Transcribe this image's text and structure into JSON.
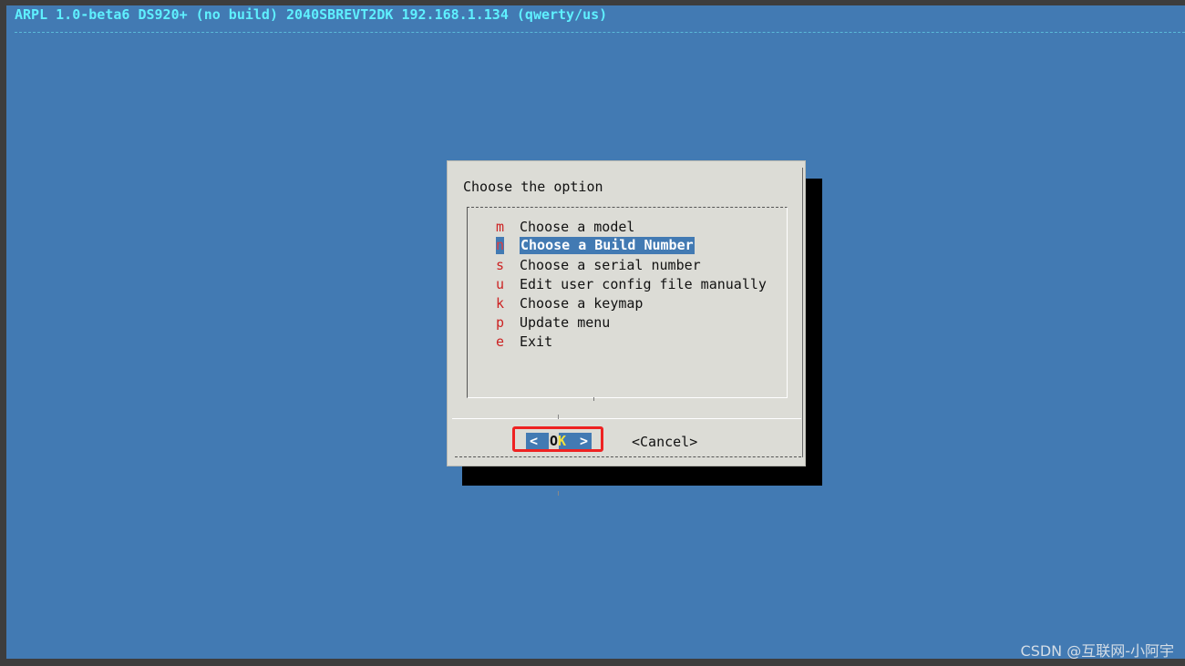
{
  "backtitle": "ARPL 1.0-beta6 DS920+ (no build) 2040SBREVT2DK 192.168.1.134 (qwerty/us)",
  "dialog": {
    "title": "Choose the option",
    "menu": [
      {
        "key": "m",
        "label": "Choose a model",
        "selected": false
      },
      {
        "key": "n",
        "label": "Choose a Build Number",
        "selected": true
      },
      {
        "key": "s",
        "label": "Choose a serial number",
        "selected": false
      },
      {
        "key": "u",
        "label": "Edit user config file manually",
        "selected": false
      },
      {
        "key": "k",
        "label": "Choose a keymap",
        "selected": false
      },
      {
        "key": "p",
        "label": "Update menu",
        "selected": false
      },
      {
        "key": "e",
        "label": "Exit",
        "selected": false
      }
    ],
    "ok_button": {
      "lt": "<",
      "first": "O",
      "second": "K",
      "gt": ">"
    },
    "cancel_button": "<Cancel>"
  },
  "watermark": "CSDN @互联网-小阿宇",
  "colors": {
    "screen_bg": "#427ab3",
    "dialog_bg": "#dcdcd6",
    "backtitle_text": "#5ff0ff",
    "hotkey": "#cc2222",
    "highlight_border": "#ee2222"
  }
}
